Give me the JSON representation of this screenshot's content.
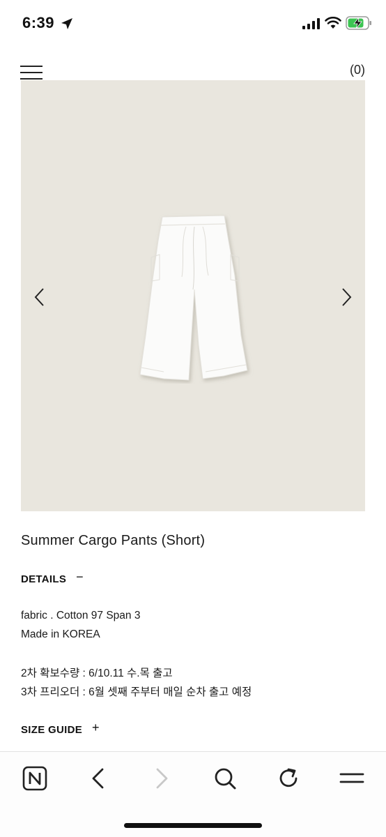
{
  "status_bar": {
    "time": "6:39",
    "icons": [
      "location-arrow-icon",
      "signal-icon",
      "wifi-icon",
      "battery-charging-icon"
    ],
    "battery_color": "#3cc452"
  },
  "header": {
    "menu_icon": "hamburger-menu-icon",
    "cart_label": "(0)"
  },
  "gallery": {
    "background_color": "#e9e6de",
    "prev_icon": "chevron-left-icon",
    "next_icon": "chevron-right-icon"
  },
  "product": {
    "title": "Summer Cargo Pants (Short)"
  },
  "details": {
    "label": "DETAILS",
    "toggle": "−",
    "lines": [
      "fabric . Cotton 97 Span 3",
      "Made in KOREA",
      "2차 확보수량 : 6/10.11 수.목 출고",
      "3차 프리오더 : 6월 셋째 주부터 매일 순차 출고 예정"
    ]
  },
  "size_guide": {
    "label": "SIZE GUIDE",
    "toggle": "+"
  },
  "toolbar": {
    "buttons": [
      "naver-n-icon",
      "back-icon",
      "forward-icon",
      "search-icon",
      "refresh-icon",
      "menu-icon"
    ]
  }
}
